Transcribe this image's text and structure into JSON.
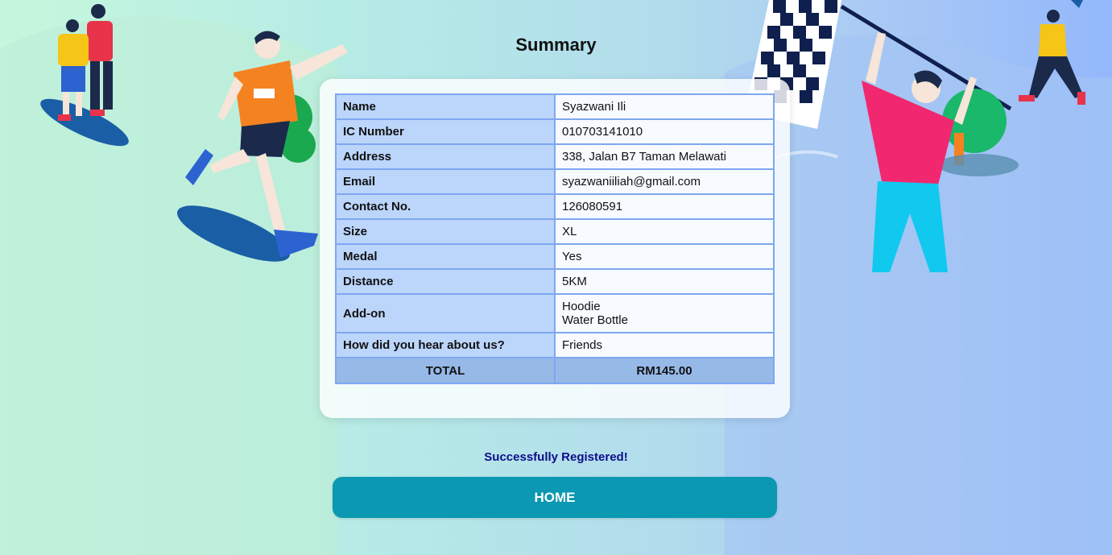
{
  "page": {
    "title": "Summary",
    "success_message": "Successfully Registered!",
    "home_button": "HOME"
  },
  "summary_rows": [
    {
      "label": "Name",
      "value": "Syazwani Ili"
    },
    {
      "label": "IC Number",
      "value": "010703141010"
    },
    {
      "label": "Address",
      "value": "338, Jalan B7 Taman Melawati"
    },
    {
      "label": "Email",
      "value": "syazwaniiliah@gmail.com"
    },
    {
      "label": "Contact No.",
      "value": "126080591"
    },
    {
      "label": "Size",
      "value": "XL"
    },
    {
      "label": "Medal",
      "value": "Yes"
    },
    {
      "label": "Distance",
      "value": "5KM"
    },
    {
      "label": "Add-on",
      "values": [
        "Hoodie",
        "Water Bottle"
      ]
    },
    {
      "label": "How did you hear about us?",
      "value": "Friends"
    }
  ],
  "total": {
    "label": "TOTAL",
    "value": "RM145.00"
  },
  "colors": {
    "button": "#0a98b2",
    "success_text": "#0d0d8a",
    "key_cell": "#b2cefa",
    "total_row": "#97b9e8",
    "table_border": "#7fa7f0"
  },
  "icons": [
    "running-kids-illustration",
    "runner-illustration",
    "flag-waver-illustration",
    "checkered-flag-icon",
    "waving-kid-illustration",
    "tree-icon"
  ]
}
